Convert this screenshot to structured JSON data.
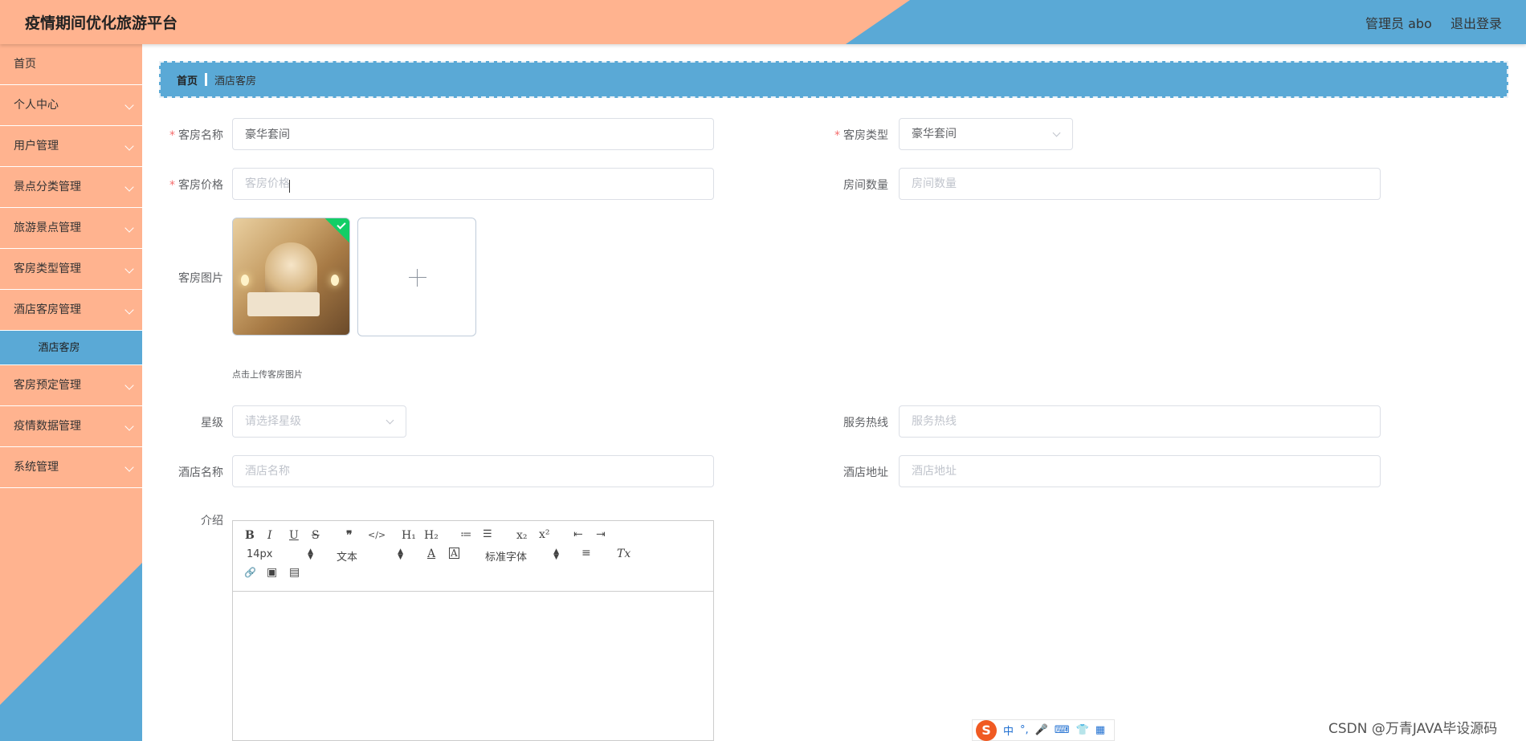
{
  "header": {
    "title": "疫情期间优化旅游平台",
    "admin_label": "管理员 abo",
    "logout_label": "退出登录"
  },
  "sidebar": {
    "items": [
      {
        "label": "首页"
      },
      {
        "label": "个人中心"
      },
      {
        "label": "用户管理"
      },
      {
        "label": "景点分类管理"
      },
      {
        "label": "旅游景点管理"
      },
      {
        "label": "客房类型管理"
      },
      {
        "label": "酒店客房管理"
      },
      {
        "label": "客房预定管理"
      },
      {
        "label": "疫情数据管理"
      },
      {
        "label": "系统管理"
      }
    ],
    "active_sub": "酒店客房"
  },
  "breadcrumb": {
    "home": "首页",
    "current": "酒店客房"
  },
  "form": {
    "room_name": {
      "label": "客房名称",
      "value": "豪华套间"
    },
    "room_type": {
      "label": "客房类型",
      "value": "豪华套间"
    },
    "room_price": {
      "label": "客房价格",
      "placeholder": "客房价格"
    },
    "room_count": {
      "label": "房间数量",
      "placeholder": "房间数量"
    },
    "room_image": {
      "label": "客房图片",
      "tip": "点击上传客房图片"
    },
    "star": {
      "label": "星级",
      "placeholder": "请选择星级"
    },
    "hotline": {
      "label": "服务热线",
      "placeholder": "服务热线"
    },
    "hotel_name": {
      "label": "酒店名称",
      "placeholder": "酒店名称"
    },
    "hotel_address": {
      "label": "酒店地址",
      "placeholder": "酒店地址"
    },
    "intro": {
      "label": "介绍"
    }
  },
  "editor": {
    "font_size": "14px",
    "header_select": "文本",
    "font_family": "标准字体",
    "buttons": {
      "bold": "B",
      "italic": "I",
      "underline": "U",
      "strike": "S",
      "blockquote": "❞",
      "code": "</>",
      "h1": "H₁",
      "h2": "H₂",
      "ordered_list": "≔",
      "bullet_list": "☰",
      "subscript": "x₂",
      "superscript": "x²",
      "outdent": "⇤",
      "indent": "⇥",
      "color": "A",
      "background": "A",
      "align": "≡",
      "clean": "Tx",
      "link": "🔗",
      "image": "▣",
      "video": "▤"
    }
  },
  "ime": {
    "logo": "S",
    "lang": "中",
    "punct": "°,",
    "mic": "🎤",
    "keyboard": "⌨",
    "skin": "👕",
    "apps": "▦"
  },
  "watermark": "CSDN @万青JAVA毕设源码"
}
